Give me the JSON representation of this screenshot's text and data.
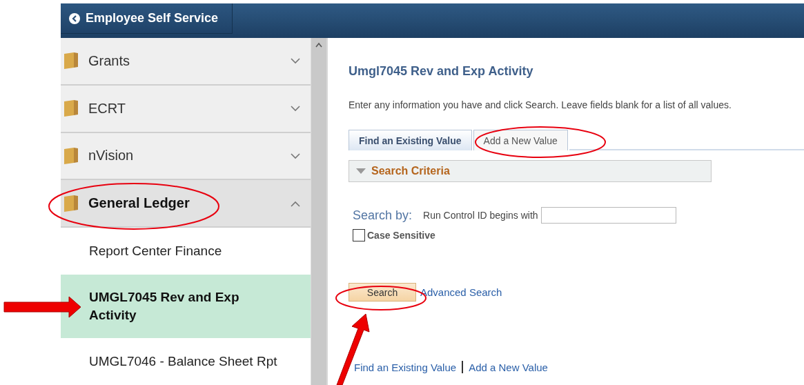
{
  "header": {
    "back_label": "Employee Self Service"
  },
  "sidebar": {
    "folders": [
      {
        "label": "Grants",
        "expanded": false
      },
      {
        "label": "ECRT",
        "expanded": false
      },
      {
        "label": "nVision",
        "expanded": false
      },
      {
        "label": "General Ledger",
        "expanded": true,
        "children": [
          {
            "label": "Report Center Finance",
            "selected": false
          },
          {
            "label": "UMGL7045 Rev and Exp Activity",
            "selected": true
          },
          {
            "label": "UMGL7046 - Balance Sheet Rpt",
            "selected": false
          }
        ]
      }
    ]
  },
  "content": {
    "title": "Umgl7045 Rev and Exp Activity",
    "instructions": "Enter any information you have and click Search. Leave fields blank for a list of all values.",
    "tabs": [
      {
        "label": "Find an Existing Value",
        "selected": true
      },
      {
        "label": "Add a New Value",
        "selected": false
      }
    ],
    "section": {
      "title": "Search Criteria",
      "expanded": true
    },
    "search_by_label": "Search by:",
    "field_label": "Run Control ID begins with",
    "case_sensitive": {
      "label": "Case Sensitive",
      "checked": false
    },
    "search_button": "Search",
    "advanced_link": "Advanced Search",
    "bottom_links": [
      "Find an Existing Value",
      "Add a New Value"
    ]
  }
}
